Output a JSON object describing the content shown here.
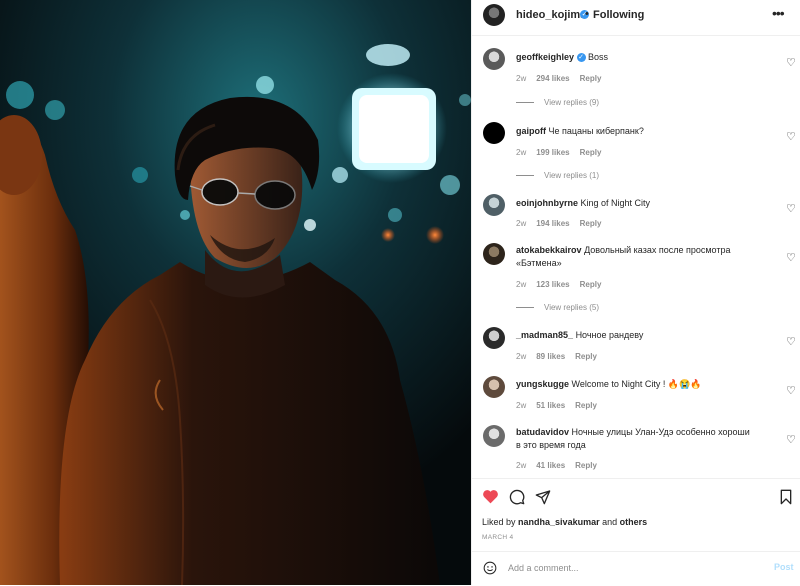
{
  "header": {
    "username": "hideo_kojima",
    "verified_icon": "verified-badge-icon",
    "separator": "•",
    "follow_status": "Following",
    "more_icon": "more-options-icon"
  },
  "comments": [
    {
      "user": "geoffkeighley",
      "verified": true,
      "text": "Boss",
      "age": "2w",
      "likes": "294 likes",
      "reply": "Reply",
      "view_replies": "View replies (9)"
    },
    {
      "user": "gaipoff",
      "text": "Че пацаны киберпанк?",
      "age": "2w",
      "likes": "199 likes",
      "reply": "Reply",
      "view_replies": "View replies (1)"
    },
    {
      "user": "eoinjohnbyrne",
      "text": "King of Night City",
      "age": "2w",
      "likes": "194 likes",
      "reply": "Reply"
    },
    {
      "user": "atokabekkairov",
      "text": "Довольный казах после просмотра «Бэтмена»",
      "age": "2w",
      "likes": "123 likes",
      "reply": "Reply",
      "view_replies": "View replies (5)"
    },
    {
      "user": "_madman85_",
      "text": "Ночное рандеву",
      "age": "2w",
      "likes": "89 likes",
      "reply": "Reply"
    },
    {
      "user": "yungskugge",
      "text": "Welcome to Night City ! 🔥😭🔥",
      "age": "2w",
      "likes": "51 likes",
      "reply": "Reply"
    },
    {
      "user": "batudavidov",
      "text": "Ночные улицы Улан-Удэ особенно хороши в это время года",
      "age": "2w",
      "likes": "41 likes",
      "reply": "Reply"
    }
  ],
  "actions": {
    "like_icon": "heart-filled-icon",
    "comment_icon": "comment-icon",
    "share_icon": "share-icon",
    "save_icon": "bookmark-icon",
    "like_color": "#ed4956"
  },
  "liked_by": {
    "prefix": "Liked by",
    "user": "nandha_sivakumar",
    "and": "and",
    "others": "others"
  },
  "date": "MARCH 4",
  "add_comment": {
    "placeholder": "Add a comment...",
    "post_label": "Post",
    "emoji_icon": "emoji-icon"
  }
}
